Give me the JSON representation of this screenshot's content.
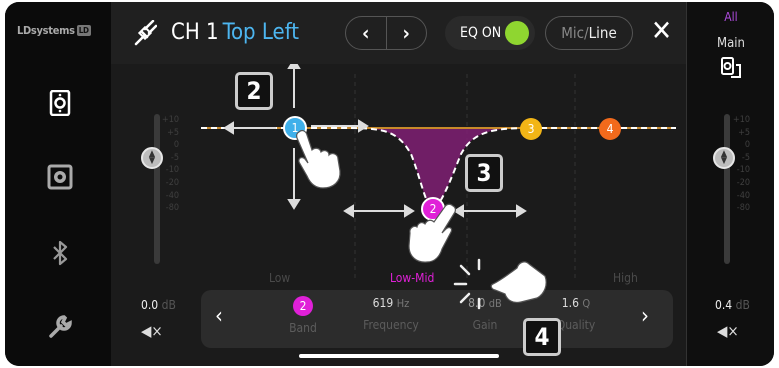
{
  "brand": {
    "name": "LDsystems",
    "badge": "LD"
  },
  "sidebar": {
    "items": [
      {
        "name": "speaker-front-icon"
      },
      {
        "name": "speaker-icon"
      },
      {
        "name": "bluetooth-icon"
      },
      {
        "name": "wrench-icon"
      }
    ]
  },
  "header": {
    "channel": "CH 1",
    "channel_name": "Top Left",
    "prev_icon": "‹",
    "next_icon": "›",
    "eq_label": "EQ ON",
    "mic_label": "Mic/",
    "line_label": "Line",
    "close_icon": "✕"
  },
  "left_channel": {
    "level": "0.0",
    "unit": "dB",
    "scale": [
      "+10",
      "+5",
      "0",
      "-5",
      "-10",
      "-20",
      "-40",
      "-80"
    ]
  },
  "right_panel": {
    "all_label": "All",
    "main_label": "Main",
    "level": "0.4",
    "unit": "dB",
    "scale": [
      "+10",
      "+5",
      "0",
      "-5",
      "-10",
      "-20",
      "-40",
      "-80"
    ]
  },
  "eq": {
    "band_regions": [
      "Low",
      "Low-Mid",
      "High"
    ],
    "handles": [
      {
        "label": "1",
        "color": "#3fb0ea"
      },
      {
        "label": "2",
        "color": "#e020d8"
      },
      {
        "label": "3",
        "color": "#f2b516"
      },
      {
        "label": "4",
        "color": "#f26a1c"
      }
    ]
  },
  "bottom": {
    "band_value": "2",
    "band_label": "Band",
    "freq_value": "619",
    "freq_unit": "Hz",
    "freq_label": "Frequency",
    "gain_value": "8.0",
    "gain_unit": "dB",
    "gain_label": "Gain",
    "q_value": "1.6",
    "q_unit": "Q",
    "q_label": "Quality"
  },
  "callouts": [
    "2",
    "3",
    "4"
  ],
  "colors": {
    "accent_blue": "#4db6f0",
    "eq_on": "#8fd630",
    "selected_band": "#e020d8",
    "purple_text": "#b04ce0"
  }
}
